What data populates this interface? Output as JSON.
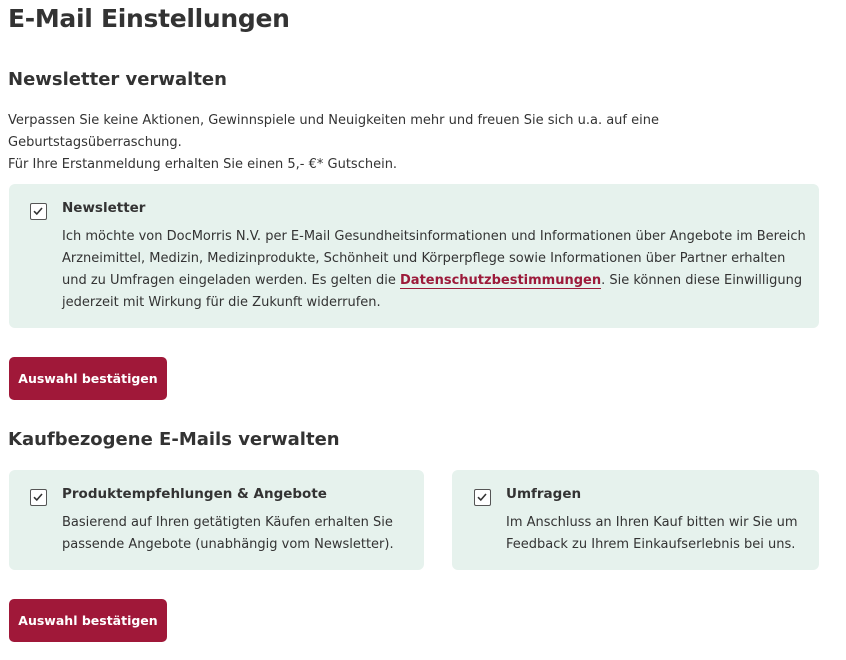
{
  "page": {
    "title": "E-Mail Einstellungen"
  },
  "newsletter_section": {
    "title": "Newsletter verwalten",
    "intro_line1": "Verpassen Sie keine Aktionen, Gewinnspiele und Neuigkeiten mehr und freuen Sie sich u.a. auf eine Geburtstagsüberraschung.",
    "intro_line2": "Für Ihre Erstanmeldung erhalten Sie einen 5,- €* Gutschein.",
    "option": {
      "title": "Newsletter",
      "checked": true,
      "desc_before": "Ich möchte von DocMorris N.V. per E-Mail Gesundheitsinformationen und Informationen über Angebote im Bereich Arzneimittel, Medizin, Medizinprodukte, Schönheit und Körperpflege sowie Informationen über Partner erhalten und zu Umfragen eingeladen werden. Es gelten die ",
      "link_text": "Datenschutzbestimmungen",
      "desc_after": ". Sie können diese Einwilligung jederzeit mit Wirkung für die Zukunft widerrufen."
    },
    "confirm_label": "Auswahl bestätigen"
  },
  "purchase_section": {
    "title": "Kaufbezogene E-Mails verwalten",
    "options": [
      {
        "title": "Produktempfehlungen & Angebote",
        "checked": true,
        "desc": "Basierend auf Ihren getätigten Käufen erhalten Sie passende Angebote (unabhängig vom Newsletter)."
      },
      {
        "title": "Umfragen",
        "checked": true,
        "desc": "Im Anschluss an Ihren Kauf bitten wir Sie um Feedback zu Ihrem Einkaufserlebnis bei uns."
      }
    ],
    "confirm_label": "Auswahl bestätigen"
  },
  "colors": {
    "accent": "#a01839",
    "box_background": "#e6f2ed",
    "text": "#333333"
  }
}
